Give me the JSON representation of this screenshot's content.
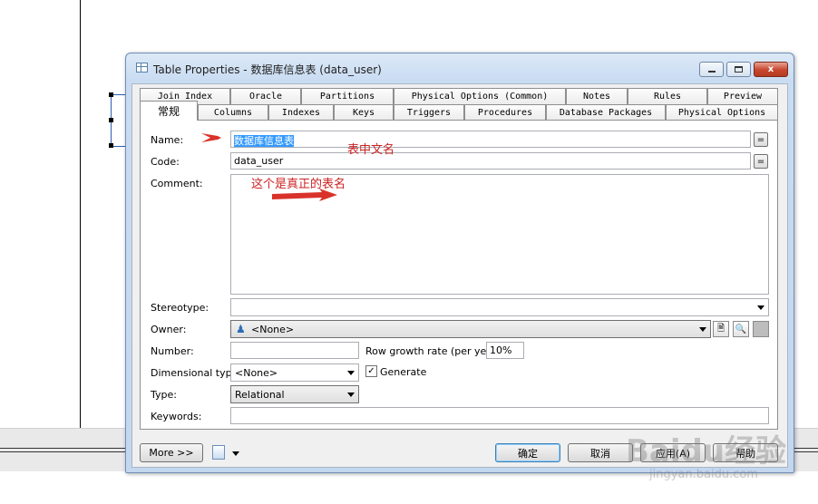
{
  "window": {
    "title": "Table Properties - 数据库信息表 (data_user)",
    "min_label": "",
    "max_label": "",
    "close_label": "x"
  },
  "tabs": {
    "row_back": [
      "Join Index",
      "Oracle",
      "Partitions",
      "Physical Options (Common)",
      "Notes",
      "Rules",
      "Preview"
    ],
    "row_front": [
      "常规",
      "Columns",
      "Indexes",
      "Keys",
      "Triggers",
      "Procedures",
      "Database Packages",
      "Physical Options"
    ],
    "active": "常规"
  },
  "form": {
    "name_label": "Name:",
    "name_value": "数据库信息表",
    "code_label": "Code:",
    "code_value": "data_user",
    "comment_label": "Comment:",
    "comment_value": "",
    "stereotype_label": "Stereotype:",
    "stereotype_value": "",
    "owner_label": "Owner:",
    "owner_value": "<None>",
    "number_label": "Number:",
    "number_value": "",
    "growth_label": "Row growth rate (per year):",
    "growth_value": "10%",
    "dimtype_label": "Dimensional type:",
    "dimtype_value": "<None>",
    "generate_label": "Generate",
    "generate_checked": "✓",
    "type_label": "Type:",
    "type_value": "Relational",
    "keywords_label": "Keywords:",
    "keywords_value": "",
    "eq_label": "="
  },
  "footer": {
    "more_label": "More >>",
    "ok_label": "确定",
    "cancel_label": "取消",
    "apply_label": "应用(A)",
    "help_label": "帮助"
  },
  "annotations": {
    "name_note": "表中文名",
    "code_note": "这个是真正的表名"
  },
  "watermark": {
    "line1": "Baidu经验",
    "line2": "jingyan.baidu.com"
  },
  "colors": {
    "annotation": "#cc2222",
    "selection": "#3399ff",
    "close_button": "#c7462d"
  }
}
